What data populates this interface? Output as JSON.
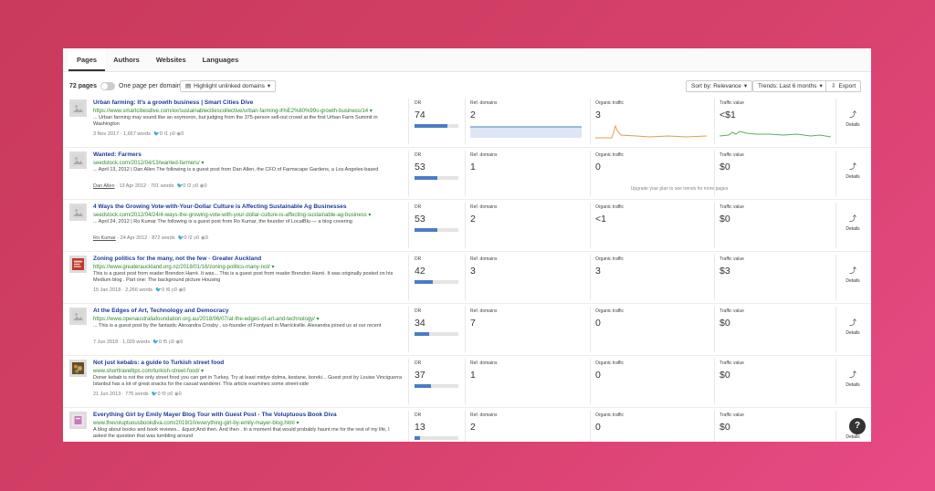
{
  "tabs": [
    "Pages",
    "Authors",
    "Websites",
    "Languages"
  ],
  "toolbar": {
    "count": "72 pages",
    "toggle_label": "One page per domain",
    "highlight_label": "Highlight unlinked domains",
    "sort_label": "Sort by: Relevance",
    "trends_label": "Trends: Last 6 months",
    "export_label": "Export"
  },
  "labels": {
    "dr": "DR",
    "ref": "Ref. domains",
    "organic": "Organic traffic",
    "tv": "Traffic value",
    "details": "Details",
    "upgrade_note": "Upgrade your plan to see trends for more pages"
  },
  "rows": [
    {
      "title": "Urban farming: It's a growth business | Smart Cities Dive",
      "url": "https://www.smartcitiesdive.com/ex/sustainablecitiescollective/urban-farming-it%E2%80%99s-growth-business/14",
      "snippet": "... Urban farming may sound like an oxymoron, but judging from the 375-person sell-out crowd at the first Urban Farm Summit in Washington",
      "author": "",
      "meta": "3 Nov 2017 · 1,657 words",
      "tw": "0",
      "fb": "1",
      "pin": "0",
      "red": "0",
      "dr": "74",
      "dr_pct": 74,
      "ref": "2",
      "organic": "3",
      "tv": "<$1",
      "thumb": "placeholder-image-icon"
    },
    {
      "title": "Wanted: Farmers",
      "url": "seedstock.com/2012/04/13/wanted-farmers/",
      "snippet": "... April 13, 2012 | Dan Allen The following is a guest post from Dan Allen, the CFO of Farmscape Gardens, a Los Angeles-based",
      "author": "Dan Allen",
      "meta": "· 13 Apr 2012 · 701 words",
      "tw": "0",
      "fb": "2",
      "pin": "0",
      "red": "0",
      "dr": "53",
      "dr_pct": 53,
      "ref": "1",
      "organic": "0",
      "tv": "$0",
      "thumb": "placeholder-image-icon"
    },
    {
      "title": "4 Ways the Growing Vote-with-Your-Dollar Culture is Affecting Sustainable Ag Businesses",
      "url": "seedstock.com/2012/04/24/4-ways-the-growing-vote-with-your-dollar-culture-is-affecting-sustainable-ag-business",
      "snippet": "... April 24, 2012 | Ro Kumar The following is a guest post from Ro Kumar, the founder of LocalBlu — a blog covering",
      "author": "Ro Kumar",
      "meta": "· 24 Apr 2012 · 872 words",
      "tw": "0",
      "fb": "2",
      "pin": "0",
      "red": "0",
      "dr": "53",
      "dr_pct": 53,
      "ref": "2",
      "organic": "<1",
      "tv": "$0",
      "thumb": "placeholder-image-icon"
    },
    {
      "title": "Zoning politics for the many, not the few - Greater Auckland",
      "url": "https://www.greaterauckland.org.nz/2018/01/16/zoning-politics-many-not/",
      "snippet": "This is a guest post from reader Brendon Harré. It was... This is a guest post from reader Brendon Harré. It was originally posted on his Medium blog . Part one: The background picture Housing",
      "author": "",
      "meta": "15 Jan 2018 · 2,266 words",
      "tw": "0",
      "fb": "6",
      "pin": "0",
      "red": "0",
      "dr": "42",
      "dr_pct": 42,
      "ref": "3",
      "organic": "3",
      "tv": "$3",
      "thumb": "red-article-thumbnail"
    },
    {
      "title": "At the Edges of Art, Technology and Democracy",
      "url": "https://www.openaustraliafoundation.org.au/2018/06/07/at-the-edges-of-art-and-technology/",
      "snippet": "... This is a guest post by the fantastic Alexandra Crosby , co-founder of Fontyard in Marrickville. Alexandra joined us at our recent",
      "author": "",
      "meta": "7 Jun 2018 · 1,029 words",
      "tw": "0",
      "fb": "5",
      "pin": "0",
      "red": "0",
      "dr": "34",
      "dr_pct": 34,
      "ref": "7",
      "organic": "0",
      "tv": "$0",
      "thumb": "placeholder-image-icon"
    },
    {
      "title": "Not just kebabs: a guide to Turkish street food",
      "url": "www.shorttraveltips.com/turkish-street-food/",
      "snippet": "Doner kebab is not the only street food you can get in Turkey. Try at least midye dolma, kestane, boreki... Guest post by Louise Vinciguerra Istanbul has a lot of great snacks for the casual wanderer. This article examines some street-side",
      "author": "",
      "meta": "21 Jun 2013 · 775 words",
      "tw": "0",
      "fb": "0",
      "pin": "0",
      "red": "0",
      "dr": "37",
      "dr_pct": 37,
      "ref": "1",
      "organic": "0",
      "tv": "$0",
      "thumb": "food-photo-thumbnail"
    },
    {
      "title": "Everything Girl by Emily Mayer Blog Tour with Guest Post - The Voluptuous Book Diva",
      "url": "www.thevoluptuousbookdiva.com/2019/10/everything-girl-by-emily-mayer-blog.html",
      "snippet": "A blog about books and book reviews... &quot;And then.  And then . In a moment that would probably haunt me for the rest of my life, I asked the question that was tumbling around",
      "author": "",
      "meta": "",
      "tw": "",
      "fb": "",
      "pin": "",
      "red": "",
      "dr": "13",
      "dr_pct": 13,
      "ref": "2",
      "organic": "0",
      "tv": "$0",
      "thumb": "book-cover-thumbnail"
    }
  ],
  "help_label": "?"
}
